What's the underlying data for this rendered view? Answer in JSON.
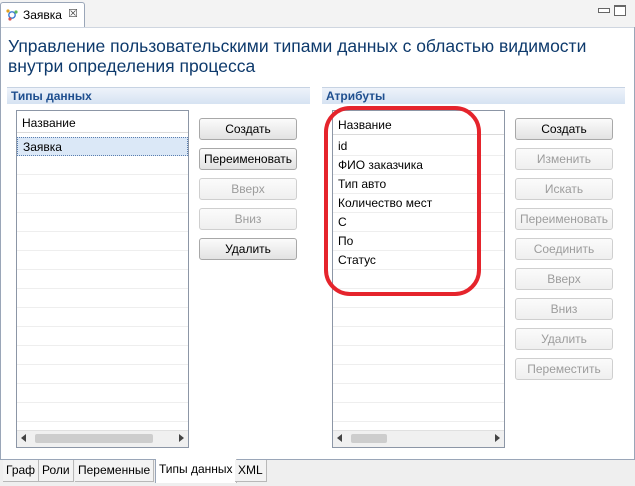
{
  "editor_tab": {
    "label": "Заявка",
    "close_glyph": "☒",
    "icon": "process-icon"
  },
  "page_title": "Управление пользовательскими типами данных с областью видимости внутри определения процесса",
  "data_types": {
    "header": "Типы данных",
    "column_header": "Название",
    "rows": [
      "Заявка"
    ],
    "buttons": {
      "create": "Создать",
      "rename": "Переименовать",
      "up": "Вверх",
      "down": "Вниз",
      "delete": "Удалить"
    }
  },
  "attributes": {
    "header": "Атрибуты",
    "column_header": "Название",
    "rows": [
      "id",
      "ФИО заказчика",
      "Тип авто",
      "Количество мест",
      "С",
      "По",
      "Статус"
    ],
    "buttons": {
      "create": "Создать",
      "edit": "Изменить",
      "search": "Искать",
      "rename": "Переименовать",
      "join": "Соединить",
      "up": "Вверх",
      "down": "Вниз",
      "delete": "Удалить",
      "move": "Переместить"
    }
  },
  "bottom_tabs": [
    "Граф",
    "Роли",
    "Переменные",
    "Типы данных",
    "XML"
  ],
  "active_bottom_tab": "Типы данных",
  "colors": {
    "title": "#0e3a6c",
    "group_header_text": "#1f4f8f",
    "highlight": "#e5242c",
    "selection": "#dbe8f7"
  }
}
